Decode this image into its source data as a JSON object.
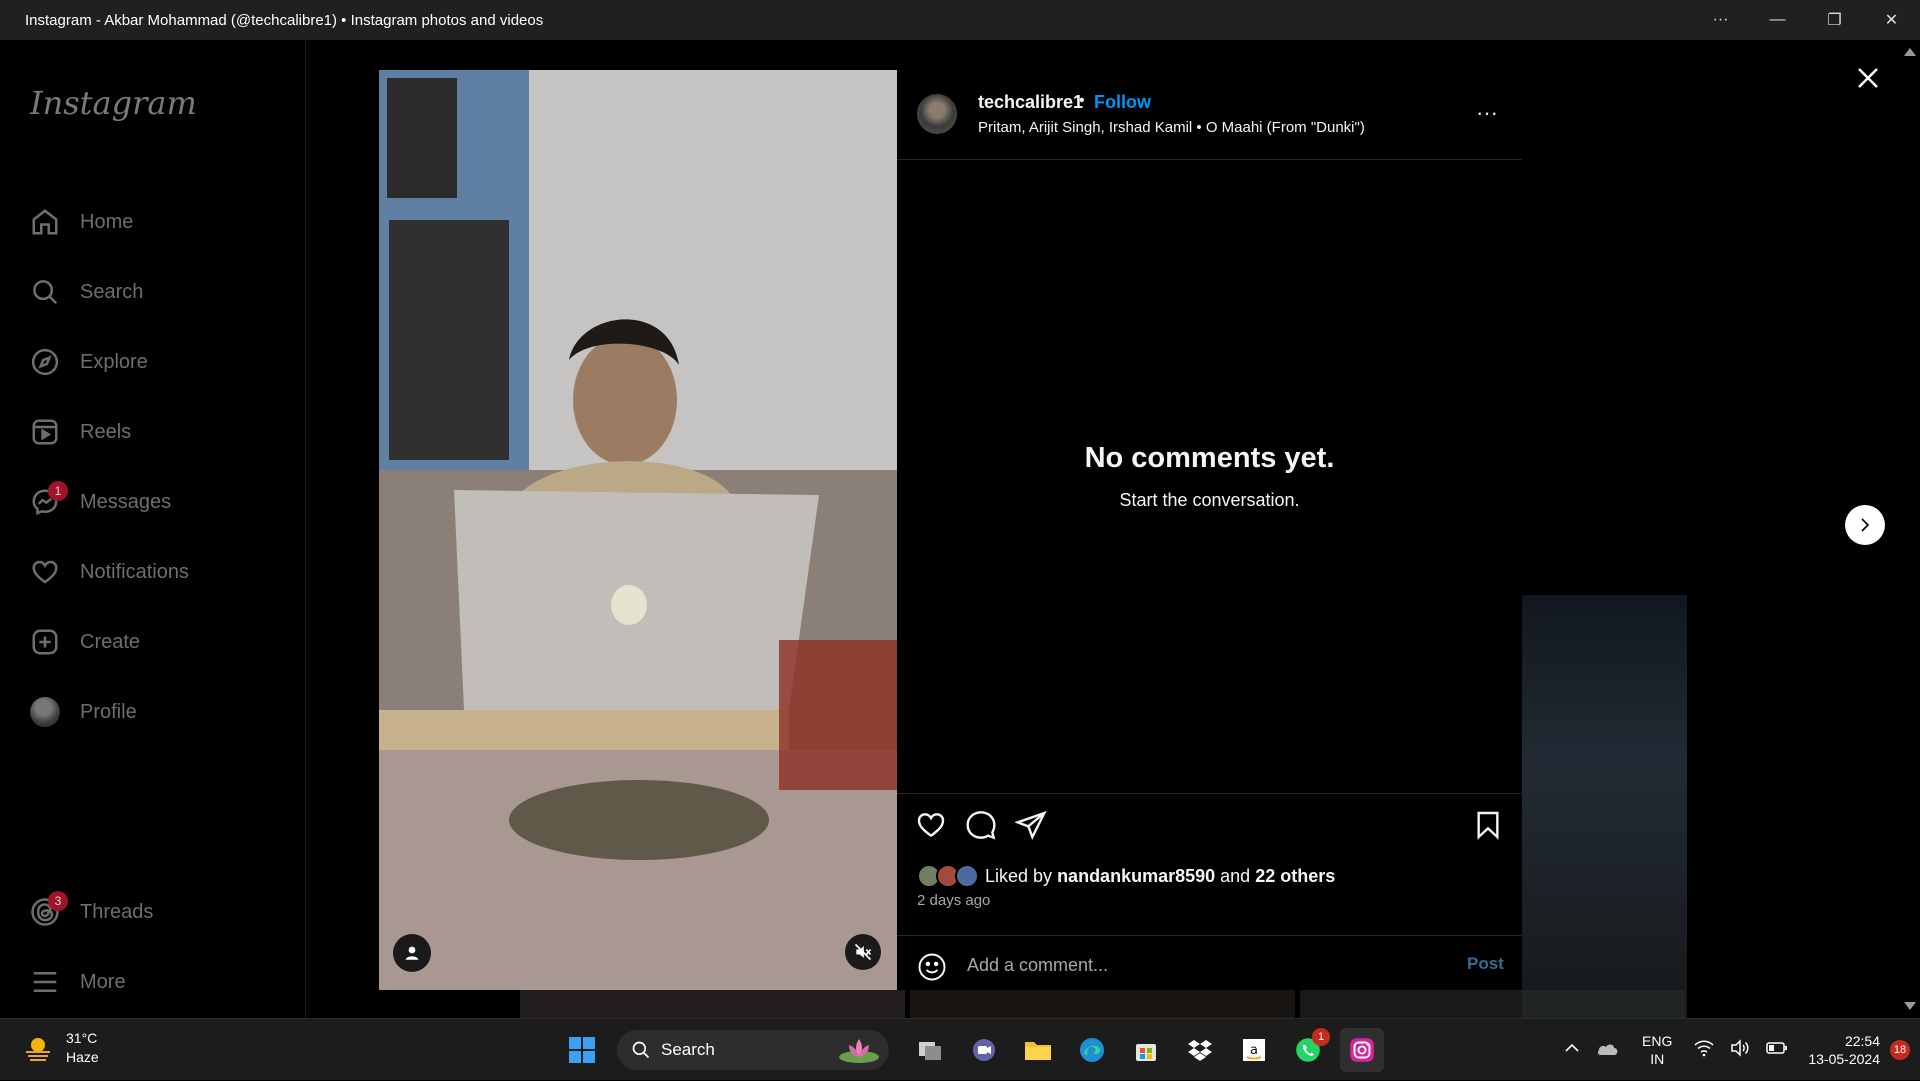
{
  "window": {
    "title": "Instagram - Akbar Mohammad (@techcalibre1) • Instagram photos and videos",
    "more_label": "···",
    "minimize_label": "—",
    "restore_label": "❐",
    "close_label": "✕"
  },
  "sidebar": {
    "logo": "Instagram",
    "items": [
      {
        "label": "Home",
        "icon": "home-icon"
      },
      {
        "label": "Search",
        "icon": "search-icon"
      },
      {
        "label": "Explore",
        "icon": "compass-icon"
      },
      {
        "label": "Reels",
        "icon": "reels-icon"
      },
      {
        "label": "Messages",
        "icon": "messenger-icon",
        "badge": "1"
      },
      {
        "label": "Notifications",
        "icon": "heart-icon"
      },
      {
        "label": "Create",
        "icon": "plus-square-icon"
      },
      {
        "label": "Profile",
        "icon": "avatar"
      }
    ],
    "bottom": [
      {
        "label": "Threads",
        "icon": "threads-icon",
        "badge": "3"
      },
      {
        "label": "More",
        "icon": "hamburger-icon"
      }
    ]
  },
  "post": {
    "username": "techcalibre1",
    "separator": "•",
    "follow_label": "Follow",
    "audio": "Pritam, Arijit Singh, Irshad Kamil • O Maahi (From \"Dunki\")",
    "more_label": "···",
    "empty_title": "No comments yet.",
    "empty_subtitle": "Start the conversation.",
    "liked_prefix": "Liked by",
    "liked_user": "nandankumar8590",
    "liked_and": "and",
    "liked_others": "22 others",
    "time_ago": "2 days ago",
    "comment_placeholder": "Add a comment...",
    "post_label": "Post"
  },
  "taskbar": {
    "temperature": "31°C",
    "condition": "Haze",
    "search_label": "Search",
    "whatsapp_badge": "1",
    "lang_line1": "ENG",
    "lang_line2": "IN",
    "time": "22:54",
    "date": "13-05-2024",
    "notification_count": "18"
  }
}
